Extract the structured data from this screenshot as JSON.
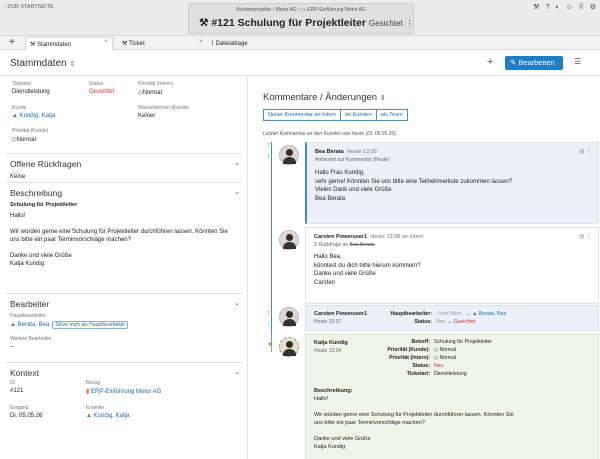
{
  "topbar": {
    "back_label": "ZUR STARTSEITE",
    "breadcrumb": [
      "Kundenprojekte",
      "Motor AG",
      "ERP-Einführung Motor AG"
    ],
    "ticket_title": "#121 Schulung für Projektleiter",
    "ticket_status": "Gesichtet"
  },
  "tabs": [
    {
      "label": "Stammdaten",
      "icon": "tools-icon"
    },
    {
      "label": "Ticket",
      "icon": "tools-icon"
    },
    {
      "label": "Dateiablage",
      "icon": "paperclip-icon"
    }
  ],
  "header": {
    "title": "Stammdaten",
    "edit_label": "Bearbeiten"
  },
  "stammdaten": {
    "ticketart_label": "Ticketart",
    "ticketart_value": "Dienstleistung",
    "status_label": "Status",
    "status_value": "Gesichtet",
    "prio_intern_label": "Priorität (Intern)",
    "prio_intern_value": "Normal",
    "kunde_label": "Kunde",
    "kunde_value": "Kundig, Katja",
    "wunsch_label": "Wunschtermin (Kunde)",
    "wunsch_value": "Keiner",
    "prio_kunde_label": "Priorität (Kunde)",
    "prio_kunde_value": "Normal"
  },
  "rueckfragen": {
    "title": "Offene Rückfragen",
    "value": "Keine"
  },
  "beschreibung": {
    "title": "Beschreibung",
    "subject": "Schulung für Projektleiter",
    "lines": [
      "Hallo!",
      "",
      "Wir würden gerne eine Schulung für Projektleiter durchführen lassen. Könnten Sie",
      "uns bitte ein paar Terminvorschläge machen?",
      "",
      "Danke und viele Grüße",
      "Katja Kundig"
    ]
  },
  "bearbeiter": {
    "title": "Bearbeiter",
    "haupt_label": "Hauptbearbeiter",
    "haupt_value": "Berata, Bea",
    "haupt_chip": "Setze mich als Hauptbearbeiter",
    "weitere_label": "Weitere Bearbeiter",
    "weitere_value": "--"
  },
  "kontext": {
    "title": "Kontext",
    "id_label": "ID",
    "id_value": "#121",
    "bezug_label": "Bezug",
    "bezug_value": "ERP-Einführung Motor AG",
    "eingang_label": "Eingang",
    "eingang_value": "Di. 05.05.26",
    "ersteller_label": "Ersteller",
    "ersteller_value": "Kundig, Katja"
  },
  "kommentare": {
    "title": "Kommentare / Änderungen",
    "buttons": [
      "Neuer Kommentar an Intern",
      "an Kunden",
      "als Team"
    ],
    "last_comment": "Letzter Kommentar an den Kunden war heute (Di. 05.05.26)"
  },
  "comments": [
    {
      "name": "Bea Berata",
      "time": "Heute 13:39",
      "sub": "Antwortet auf Kommentar (Heute)",
      "lines": [
        "Hallo Frau Kundig,",
        "sehr gerne! Könnten Sie uns bitte eine Teilnehmerliste zukommen lassen?",
        "Vielen Dank und viele Grüße",
        "Bea Berata"
      ]
    },
    {
      "name": "Carsten Poweruser1",
      "time": "Heute 13:38 an Intern",
      "sub_a": "Rückfrage an",
      "sub_b": "Bea Berata",
      "lines": [
        "Hallo Bea,",
        "könntest du dich bitte hierum kümmern?",
        "Danke und viele Grüße",
        "Carsten"
      ]
    }
  ],
  "change": {
    "name": "Carsten Poweruser1",
    "time": "Heute 13:37",
    "haupt_key": "Hauptbearbeiter:",
    "haupt_old": "- kein Wert -",
    "haupt_new": "Berata, Bea",
    "status_key": "Status:",
    "status_old": "Neu",
    "status_new": "Gesichtet"
  },
  "created": {
    "name": "Katja Kundig",
    "time": "Heute 13:34",
    "rows": [
      {
        "k": "Betreff:",
        "v": "Schulung für Projektleiter"
      },
      {
        "k": "Priorität (Kunde):",
        "v": "Normal"
      },
      {
        "k": "Priorität (Intern):",
        "v": "Normal"
      },
      {
        "k": "Status:",
        "v": "Neu"
      },
      {
        "k": "Ticketart:",
        "v": "Dienstleistung"
      }
    ],
    "desc_label": "Beschreibung:",
    "desc_lines": [
      "Hallo!",
      "",
      "Wir würden gerne eine Schulung für Projektleiter durchführen lassen. Könnten Sie",
      "uns bitte ein paar Terminvorschläge machen?",
      "",
      "Danke und viele Grüße",
      "Katja Kundig"
    ]
  }
}
